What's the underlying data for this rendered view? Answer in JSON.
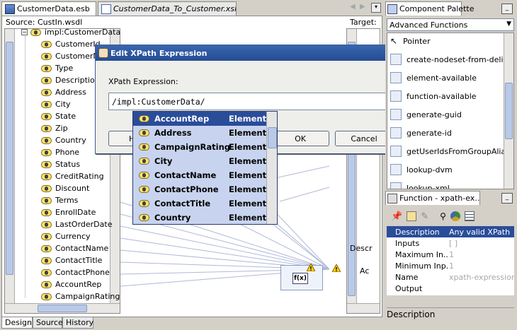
{
  "editor_tabs": [
    {
      "label": "CustomerData.esb"
    },
    {
      "label": "CustomerData_To_Customer.xsl"
    }
  ],
  "source_header": "Source: CustIn.wsdl",
  "target_header": "Target: C",
  "source_root": "impl:CustomerData",
  "source_fields": [
    "CustomerId",
    "CustomerN",
    "Type",
    "Description",
    "Address",
    "City",
    "State",
    "Zip",
    "Country",
    "Phone",
    "Status",
    "CreditRating",
    "Discount",
    "Terms",
    "EnrollDate",
    "LastOrderDate",
    "Currency",
    "ContactName",
    "ContactTitle",
    "ContactPhone",
    "AccountRep",
    "CampaignRating"
  ],
  "target_labels": {
    "desc": "Descr",
    "ac": "Ac"
  },
  "function_node_label": "f(x)",
  "bottom_tabs": [
    "Design",
    "Source",
    "History"
  ],
  "dialog": {
    "title": "Edit XPath Expression",
    "label": "XPath Expression:",
    "value": "/impl:CustomerData/",
    "ok": "OK",
    "cancel": "Cancel",
    "help_partial": "H"
  },
  "autocomplete": [
    {
      "name": "AccountRep",
      "type": "Element"
    },
    {
      "name": "Address",
      "type": "Element"
    },
    {
      "name": "CampaignRating",
      "type": "Element"
    },
    {
      "name": "City",
      "type": "Element"
    },
    {
      "name": "ContactName",
      "type": "Element"
    },
    {
      "name": "ContactPhone",
      "type": "Element"
    },
    {
      "name": "ContactTitle",
      "type": "Element"
    },
    {
      "name": "Country",
      "type": "Element"
    }
  ],
  "palette": {
    "title": "Component Palette",
    "dropdown": "Advanced Functions",
    "items": [
      "Pointer",
      "create-nodeset-from-deli...",
      "element-available",
      "function-available",
      "generate-guid",
      "generate-id",
      "getUserIdsFromGroupAlias",
      "lookup-dvm",
      "lookup-xml"
    ]
  },
  "function_panel": {
    "title": "Function - xpath-ex...",
    "properties": [
      {
        "key": "Description",
        "value": "Any valid XPath"
      },
      {
        "key": "Inputs",
        "value": "[ ]"
      },
      {
        "key": "Maximum In...",
        "value": "1"
      },
      {
        "key": "Minimum Inp...",
        "value": "1"
      },
      {
        "key": "Name",
        "value": "xpath-expression"
      },
      {
        "key": "Output",
        "value": ""
      }
    ],
    "footer": "Description"
  }
}
